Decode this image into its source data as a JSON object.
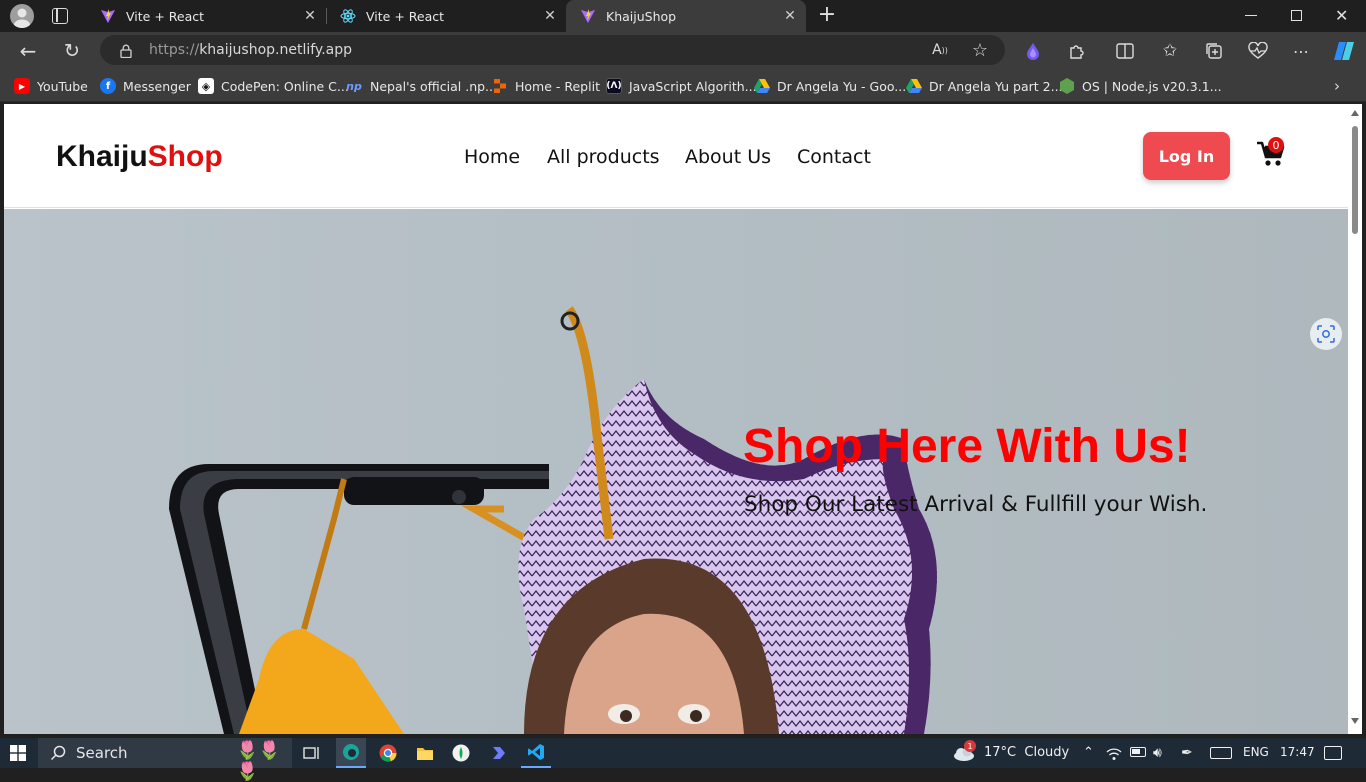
{
  "browser": {
    "tabs": [
      {
        "title": "Vite + React",
        "icon": "vite-icon",
        "active": false
      },
      {
        "title": "Vite + React",
        "icon": "react-icon",
        "active": false
      },
      {
        "title": "KhaijuShop",
        "icon": "vite-icon",
        "active": true
      }
    ],
    "url_protocol": "https://",
    "url_host": "khaijushop.netlify.app",
    "bookmarks": [
      {
        "label": "YouTube",
        "icon": "youtube-icon",
        "color": "#ff0000"
      },
      {
        "label": "Messenger",
        "icon": "facebook-icon",
        "color": "#1877f2"
      },
      {
        "label": "CodePen: Online C...",
        "icon": "codepen-icon",
        "color": "#ffffff"
      },
      {
        "label": "Nepal's official .np...",
        "icon": "np-icon",
        "color": "#3a6fd8"
      },
      {
        "label": "Home - Replit",
        "icon": "replit-icon",
        "color": "#f26207"
      },
      {
        "label": "JavaScript Algorith...",
        "icon": "freecodecamp-icon",
        "color": "#0a0a23"
      },
      {
        "label": "Dr Angela Yu - Goo...",
        "icon": "drive-icon",
        "color": "#1fa463"
      },
      {
        "label": "Dr Angela Yu part 2...",
        "icon": "drive-icon",
        "color": "#1fa463"
      },
      {
        "label": "OS | Node.js v20.3.1...",
        "icon": "nodejs-icon",
        "color": "#5fa04e"
      }
    ]
  },
  "site": {
    "logo_part1": "Khaiju",
    "logo_part2": "Shop",
    "nav": [
      "Home",
      "All products",
      "About Us",
      "Contact"
    ],
    "login_label": "Log In",
    "cart_count": "0",
    "hero_title": "Shop Here With Us!",
    "hero_subtitle": "Shop Our Latest Arrival & Fullfill your Wish."
  },
  "taskbar": {
    "search_label": "Search",
    "weather": "17°C  Cloudy",
    "weather_badge": "1",
    "lang": "ENG",
    "time": "17:47"
  },
  "colors": {
    "accent_red": "#e01010",
    "login_button": "#ef4a4f",
    "hero_bg": "#b3bec4"
  }
}
